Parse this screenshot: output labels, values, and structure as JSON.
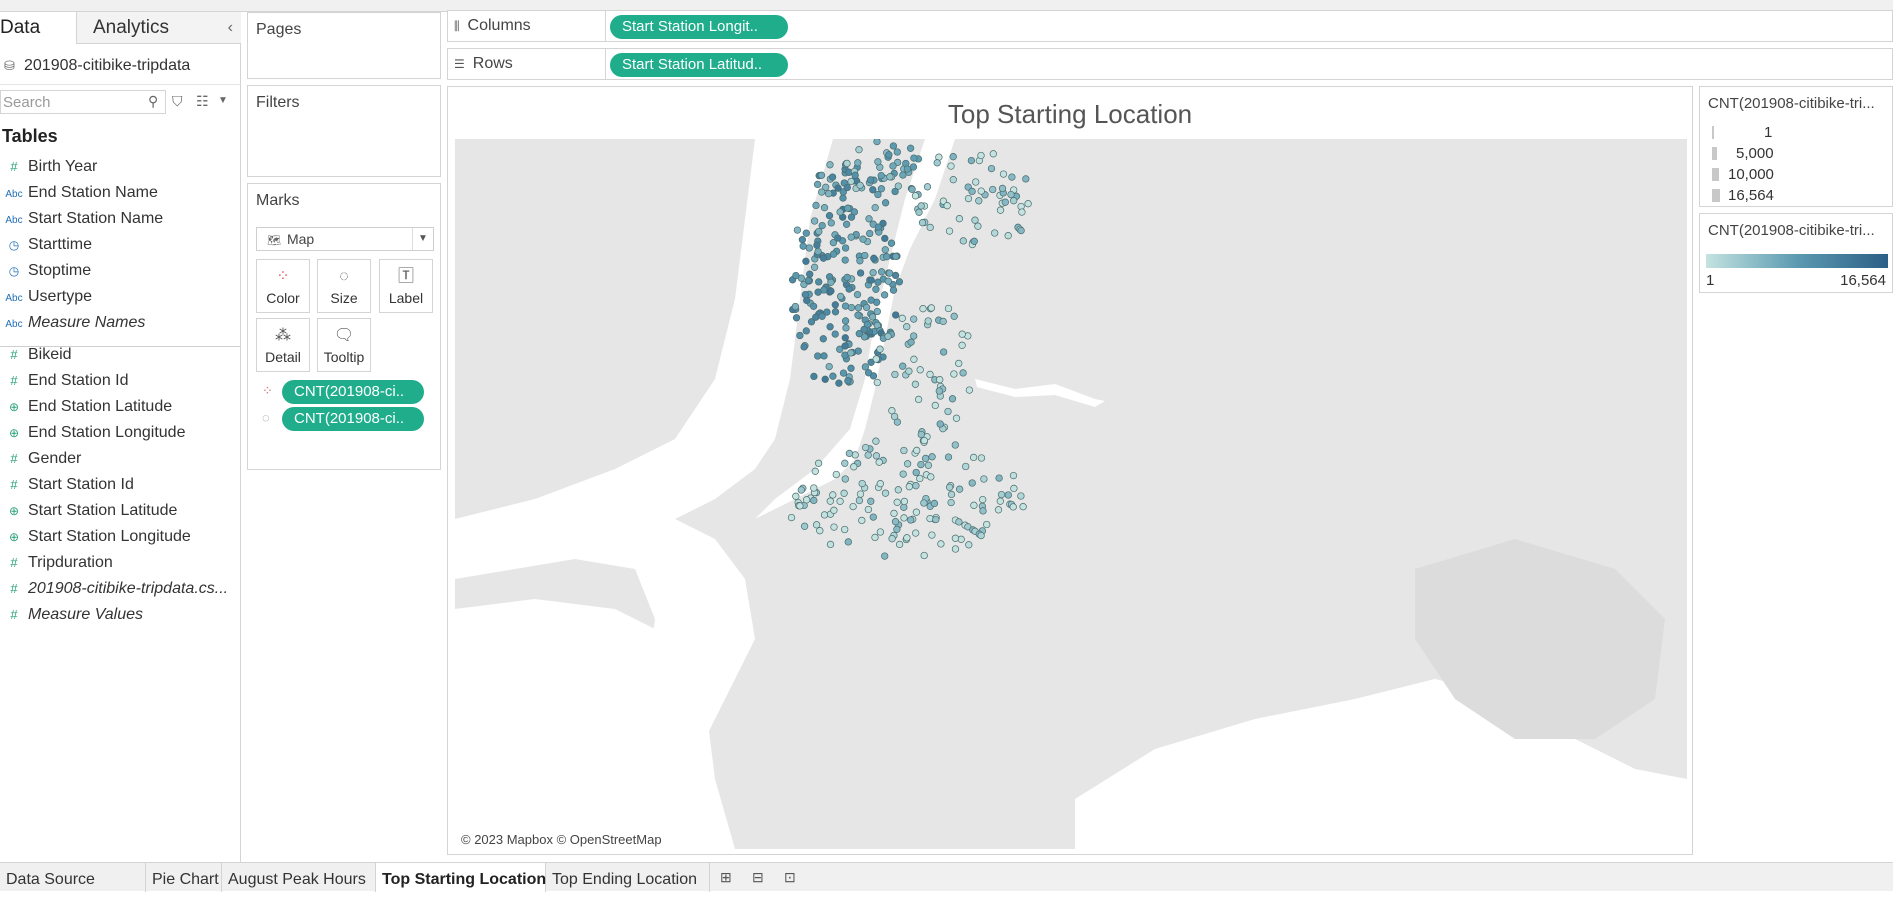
{
  "data_pane": {
    "tabs": [
      "Data",
      "Analytics"
    ],
    "datasource": "201908-citibike-tripdata",
    "search_placeholder": "Search",
    "tables_heading": "Tables",
    "dimensions": [
      {
        "name": "Birth Year",
        "type": "number"
      },
      {
        "name": "End Station Name",
        "type": "string"
      },
      {
        "name": "Start Station Name",
        "type": "string"
      },
      {
        "name": "Starttime",
        "type": "datetime"
      },
      {
        "name": "Stoptime",
        "type": "datetime"
      },
      {
        "name": "Usertype",
        "type": "string"
      },
      {
        "name": "Measure Names",
        "type": "string"
      }
    ],
    "measures": [
      {
        "name": "Bikeid",
        "type": "number"
      },
      {
        "name": "End Station Id",
        "type": "number"
      },
      {
        "name": "End Station Latitude",
        "type": "geo"
      },
      {
        "name": "End Station Longitude",
        "type": "geo"
      },
      {
        "name": "Gender",
        "type": "number"
      },
      {
        "name": "Start Station Id",
        "type": "number"
      },
      {
        "name": "Start Station Latitude",
        "type": "geo"
      },
      {
        "name": "Start Station Longitude",
        "type": "geo"
      },
      {
        "name": "Tripduration",
        "type": "number"
      },
      {
        "name": "201908-citibike-tripdata.cs...",
        "type": "number"
      },
      {
        "name": "Measure Values",
        "type": "number"
      }
    ]
  },
  "shelves": {
    "pages": "Pages",
    "filters": "Filters",
    "columns_label": "Columns",
    "columns_pill": "Start Station Longit..",
    "rows_label": "Rows",
    "rows_pill": "Start Station Latitud.."
  },
  "marks": {
    "title": "Marks",
    "type": "Map",
    "buttons": [
      "Color",
      "Size",
      "Label",
      "Detail",
      "Tooltip"
    ],
    "pills": [
      "CNT(201908-ci..",
      "CNT(201908-ci.."
    ]
  },
  "viz": {
    "title": "Top Starting Location",
    "credit": "© 2023 Mapbox © OpenStreetMap"
  },
  "legends": {
    "size_title": "CNT(201908-citibike-tri...",
    "size_items": [
      "1",
      "5,000",
      "10,000",
      "16,564"
    ],
    "color_title": "CNT(201908-citibike-tri...",
    "color_min": "1",
    "color_max": "16,564",
    "color_ramp": [
      "#c4e3e0",
      "#5b9ab1",
      "#2c5f86"
    ]
  },
  "sheet_tabs": [
    "Data Source",
    "Pie Chart",
    "August Peak Hours",
    "Top Starting Location",
    "Top Ending Location"
  ],
  "active_tab": "Top Starting Location",
  "colors": {
    "pill": "#1fad8c",
    "map_land": "#e6e6e6",
    "map_water": "#ffffff"
  }
}
